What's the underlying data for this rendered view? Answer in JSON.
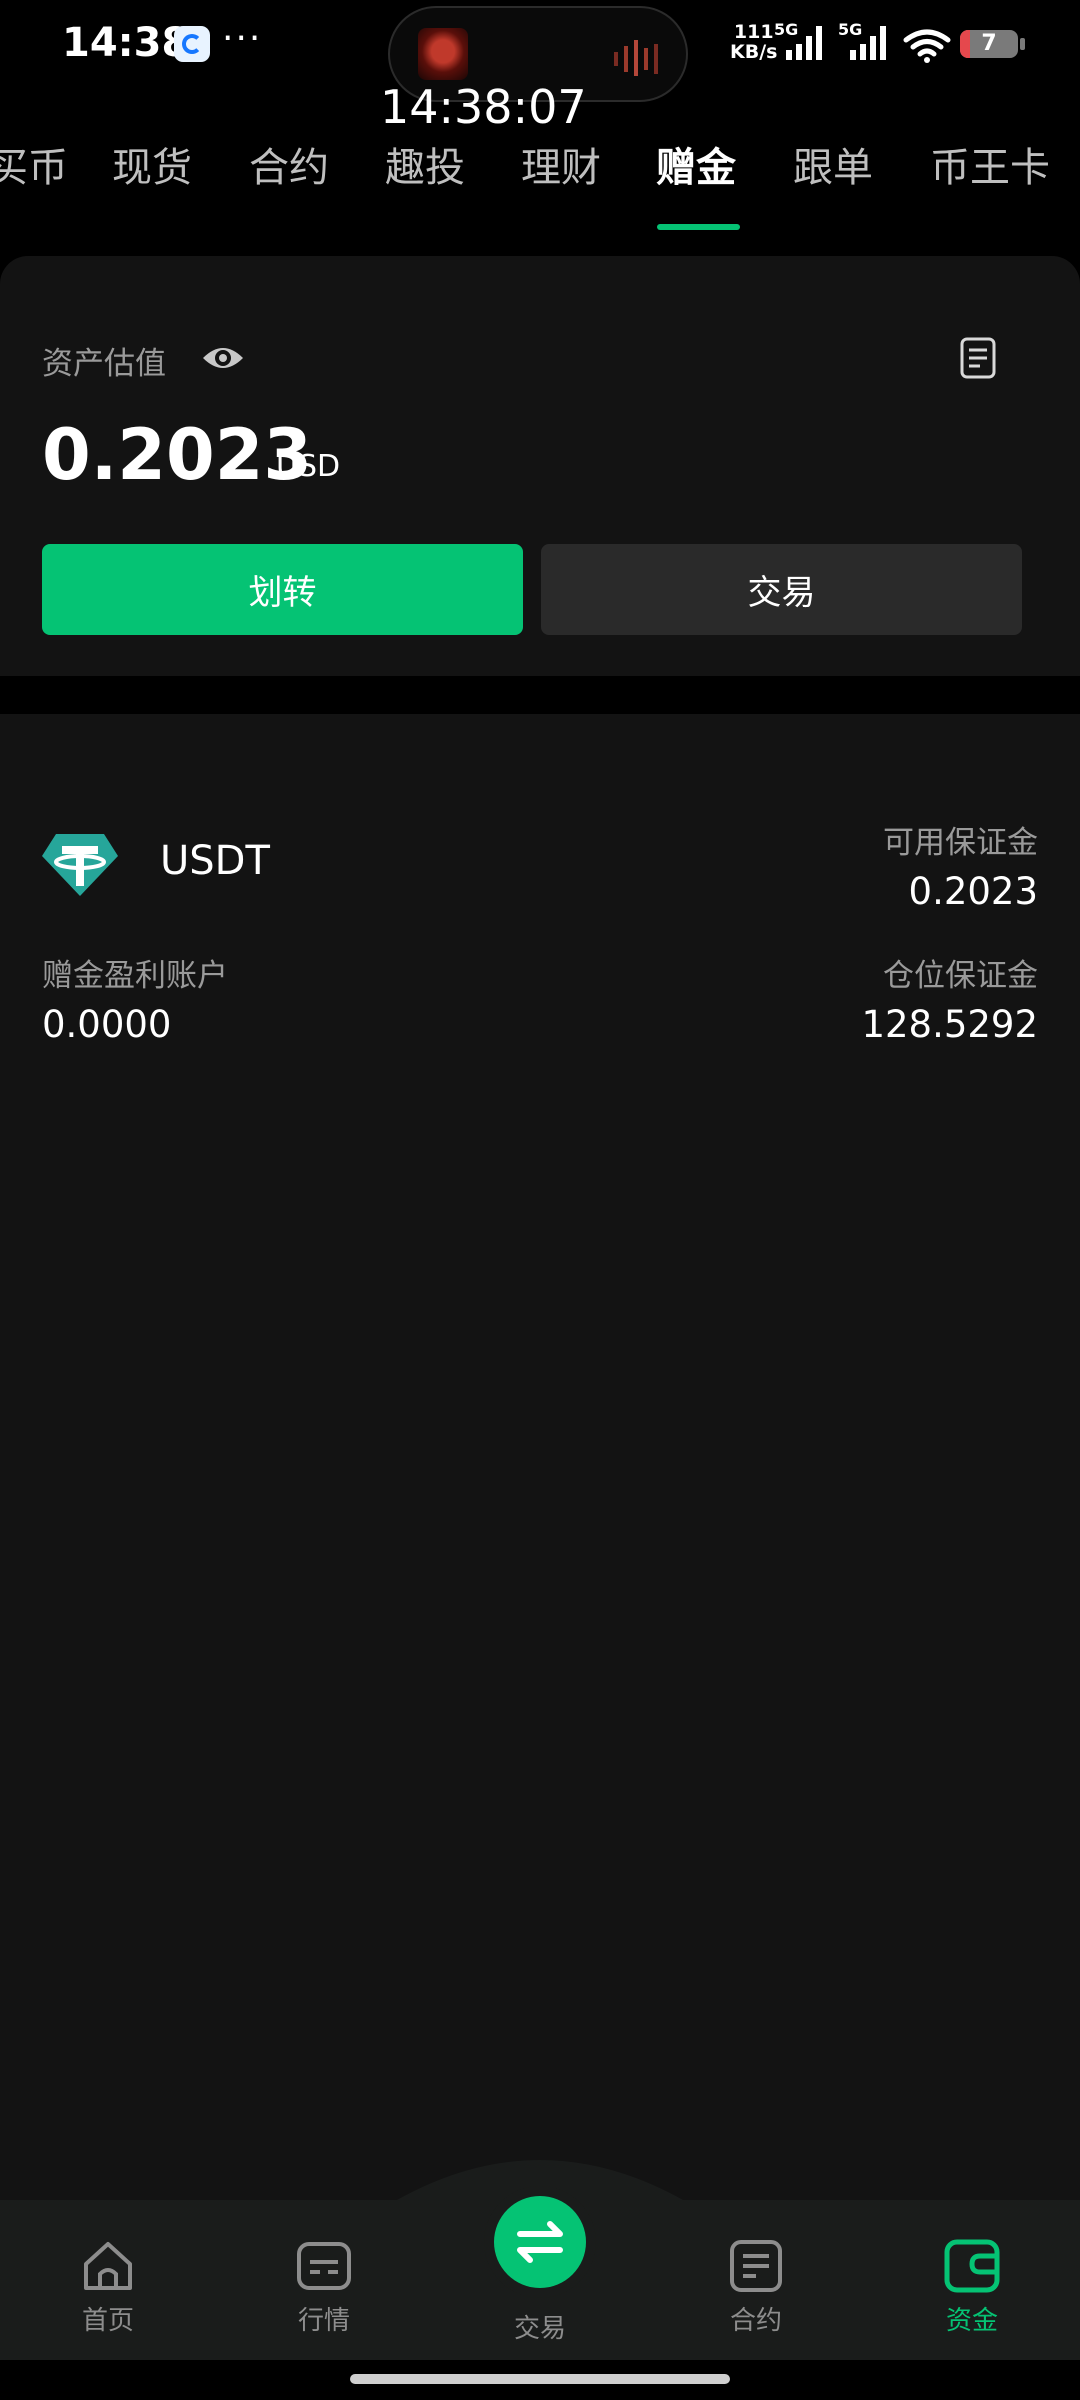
{
  "status_bar": {
    "time": "14:38",
    "dots": "···",
    "clock_overlay": "14:38:07",
    "speed_value": "111",
    "speed_unit": "KB/s",
    "signal1_label": "5G",
    "signal2_label": "5G",
    "battery": "7"
  },
  "tabs": [
    {
      "label": "买币"
    },
    {
      "label": "现货"
    },
    {
      "label": "合约"
    },
    {
      "label": "趣投"
    },
    {
      "label": "理财"
    },
    {
      "label": "赠金",
      "active": true
    },
    {
      "label": "跟单"
    },
    {
      "label": "币王卡"
    }
  ],
  "asset": {
    "label": "资产估值",
    "value": "0.2023",
    "unit": "USD",
    "transfer_label": "划转",
    "trade_label": "交易"
  },
  "account": {
    "coin": "USDT",
    "available_margin_label": "可用保证金",
    "available_margin_value": "0.2023",
    "bonus_profit_label": "赠金盈利账户",
    "bonus_profit_value": "0.0000",
    "position_margin_label": "仓位保证金",
    "position_margin_value": "128.5292"
  },
  "bottom_nav": [
    {
      "label": "首页",
      "icon": "home-icon"
    },
    {
      "label": "行情",
      "icon": "market-icon"
    },
    {
      "label": "交易",
      "icon": "swap-icon"
    },
    {
      "label": "合约",
      "icon": "contract-icon"
    },
    {
      "label": "资金",
      "icon": "wallet-icon",
      "active": true
    }
  ],
  "colors": {
    "accent": "#05c374",
    "background": "#131313",
    "secondary_text": "#9a9a9a"
  }
}
